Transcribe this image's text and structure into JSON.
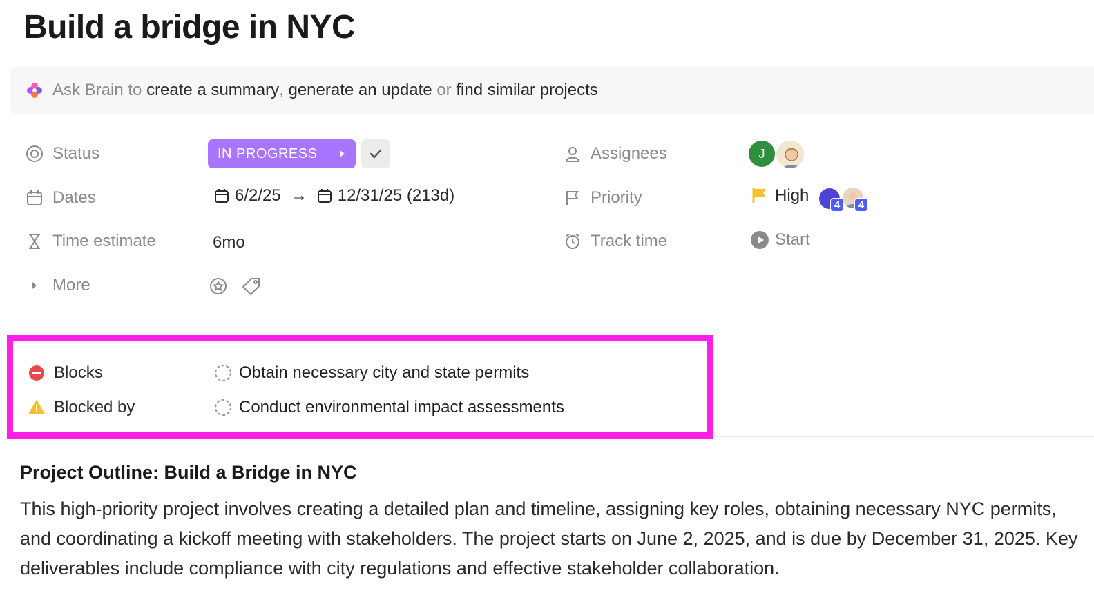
{
  "title": "Build a bridge in NYC",
  "brain_bar": {
    "prefix": "Ask Brain to",
    "action1": "create a summary",
    "sep": ",",
    "action2": "generate an update",
    "or": "or",
    "action3": "find similar projects"
  },
  "fields": {
    "status": {
      "label": "Status",
      "value": "IN PROGRESS",
      "color": "#a875ff"
    },
    "dates": {
      "label": "Dates",
      "start": "6/2/25",
      "arrow": "→",
      "end": "12/31/25 (213d)"
    },
    "time_estimate": {
      "label": "Time estimate",
      "value": "6mo"
    },
    "more": {
      "label": "More"
    },
    "assignees": {
      "label": "Assignees",
      "avatar_initial": "J"
    },
    "priority": {
      "label": "Priority",
      "value": "High",
      "flag_color": "#f8c02c",
      "badge1": "4",
      "badge2": "4"
    },
    "track_time": {
      "label": "Track time",
      "action": "Start"
    }
  },
  "dependencies": {
    "blocks": {
      "label": "Blocks",
      "task": "Obtain necessary city and state permits"
    },
    "blocked_by": {
      "label": "Blocked by",
      "task": "Conduct environmental impact assessments"
    }
  },
  "outline": {
    "heading": "Project Outline: Build a Bridge in NYC",
    "body": "This high-priority project involves creating a detailed plan and timeline, assigning key roles, obtaining necessary NYC permits, and coordinating a kickoff meeting with stakeholders. The project starts on June 2, 2025, and is due by December 31, 2025. Key deliverables include compliance with city regulations and effective stakeholder collaboration."
  }
}
